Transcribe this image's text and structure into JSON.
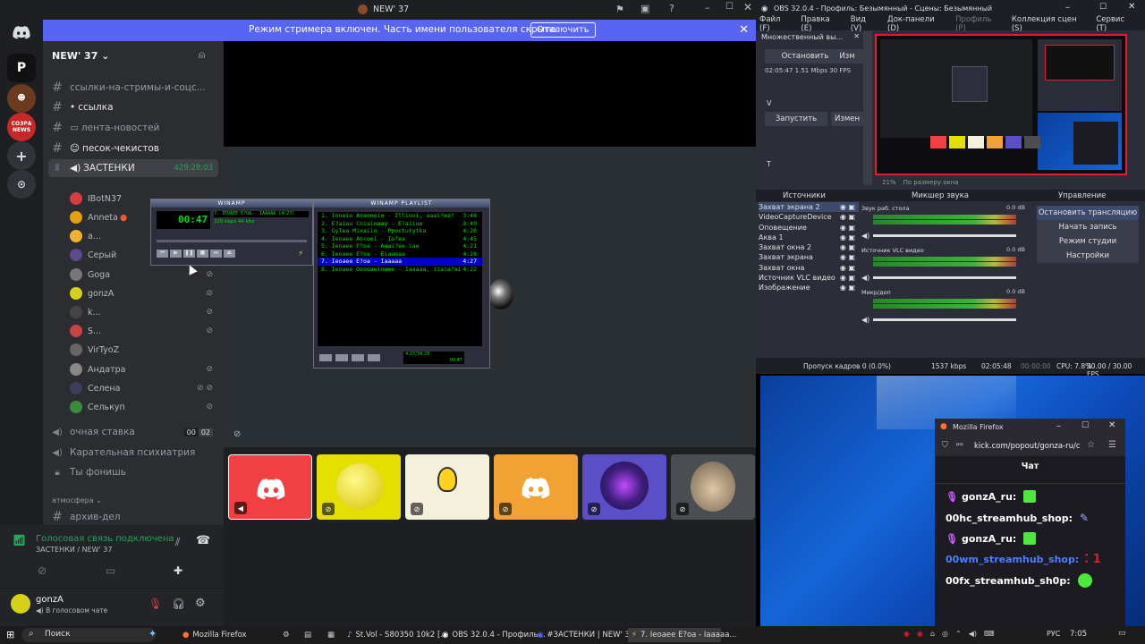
{
  "discord": {
    "window_title": "NEW' 37",
    "banner": {
      "text": "Режим стримера включен. Часть имени пользователя скрыта.",
      "button": "Отключить"
    },
    "server_name": "NEW' 37",
    "channels": [
      {
        "label": "ссылки-на-стримы-и-соцс...",
        "type": "text"
      },
      {
        "label": "ссылка",
        "type": "text",
        "prefix": "•"
      },
      {
        "label": "лента-новостей",
        "type": "text",
        "prefix": "▭"
      },
      {
        "label": "песок-чекистов",
        "type": "text",
        "prefix": "☺"
      },
      {
        "label": "ЗАСТЕНКИ",
        "type": "voice",
        "timer": "429:28:03"
      }
    ],
    "voice_users": [
      {
        "name": "IBotN37",
        "color": "#d83c3e"
      },
      {
        "name": "Anneta",
        "color": "#e5a00d"
      },
      {
        "name": "a...",
        "color": "#f0b232"
      },
      {
        "name": "Серый",
        "color": "#5b4a8c"
      },
      {
        "name": "Goga",
        "color": "#777777"
      },
      {
        "name": "gonzA",
        "color": "#d6d21c"
      },
      {
        "name": "k...",
        "color": "#444444"
      },
      {
        "name": "S...",
        "color": "#c94343"
      },
      {
        "name": "VirTyoZ",
        "color": "#666666"
      },
      {
        "name": "Андатра",
        "color": "#888888"
      },
      {
        "name": "Селена",
        "color": "#3d3d5c"
      },
      {
        "name": "Селькуп",
        "color": "#3a8c3a"
      }
    ],
    "more_channels": [
      {
        "label": "очная ставка",
        "type": "voice",
        "count_a": "00",
        "count_b": "02"
      },
      {
        "label": "Карательная психиатрия",
        "type": "voice"
      },
      {
        "label": "Ты фонишь",
        "type": "voice-locked"
      }
    ],
    "category": "атмосфера",
    "archive": "архив-дел",
    "voice_status": "Голосовая связь подключена",
    "voice_location": "ЗАСТЕНКИ / NEW' 37",
    "user": {
      "name": "gonzA",
      "status": "В голосовом чате"
    }
  },
  "winamp": {
    "title": "WINAMP",
    "time": "00:47",
    "track": "7. IEOAEE E?OA - IAAAAA (4:27)",
    "kbps": "320",
    "khz": "44",
    "playlist_title": "WINAMP PLAYLIST",
    "playlist": [
      {
        "n": "1.",
        "title": "Iooeio Aoaonoio - Illiooi, aaai?ea?",
        "dur": "3:48"
      },
      {
        "n": "2.",
        "title": "E?aiau Cniainaay - E?aiiue",
        "dur": "3:40"
      },
      {
        "n": "3.",
        "title": "Gylea Mixaiin - Ppoctutytka",
        "dur": "4:26"
      },
      {
        "n": "4.",
        "title": "Ieoaee Aocuei - Io?ea",
        "dur": "4:45"
      },
      {
        "n": "5.",
        "title": "Ieoaee E?oa - Aaai?ee iae",
        "dur": "4:21"
      },
      {
        "n": "6.",
        "title": "Ieoaee E?oa - Eiauoaa",
        "dur": "4:28"
      },
      {
        "n": "7.",
        "title": "Ieoaee E?oa - Iaaaaa",
        "dur": "4:27",
        "selected": true
      },
      {
        "n": "8.",
        "title": "Ieoaee Ooooaeinaee - Iaaaaa, iiaia?ei",
        "dur": "4:22"
      }
    ],
    "pl_time": "4:27/34:28",
    "pl_pos": "00:47"
  },
  "obs": {
    "title": "OBS 32.0.4 - Профиль: Безымянный - Сцены: Безымянный",
    "menu": [
      "Файл (F)",
      "Правка (E)",
      "Вид (V)",
      "Док-панели (D)",
      "Профиль (P)",
      "Коллекция сцен (S)",
      "Сервис (T)"
    ],
    "dock_title": "Множественный вы...",
    "stop_btn": "Остановить",
    "stats": "02:05:47  1.51 Mbps  30 FPS",
    "start_btn": "Запустить",
    "v_label": "V",
    "t_label": "T",
    "zoom": "21%",
    "fit_label": "По размеру окна",
    "sources_header": "Источники",
    "mixer_header": "Микшер звука",
    "controls_header": "Управление",
    "sources": [
      {
        "name": "Захват экрана 2",
        "selected": true
      },
      {
        "name": "VideoCaptureDevice"
      },
      {
        "name": "Оповещение"
      },
      {
        "name": "Аква 1"
      },
      {
        "name": "Захват окна 2"
      },
      {
        "name": "Захват экрана"
      },
      {
        "name": "Захват окна"
      },
      {
        "name": "Источник VLC видео"
      },
      {
        "name": "Изображение"
      }
    ],
    "mixer": [
      {
        "name": "Звук раб. стола",
        "db": "0.0 dB"
      },
      {
        "name": "Источник VLC видео",
        "db": "0.0 dB"
      },
      {
        "name": "Микр/доп",
        "db": "0.0 dB"
      }
    ],
    "controls": [
      "Остановить трансляцию",
      "Начать запись",
      "Режим студии",
      "Настройки"
    ],
    "status": {
      "dropped": "Пропуск кадров 0 (0.0%)",
      "kbps": "1537 kbps",
      "live": "02:05:48",
      "rec": "00:00:00",
      "cpu": "CPU: 7.8%",
      "fps": "30.00 / 30.00 FPS"
    }
  },
  "firefox": {
    "title": "Mozilla Firefox",
    "url": "kick.com/popout/gonza-ru/c",
    "chat_title": "Чат",
    "messages": [
      {
        "user": "gonzA_ru:",
        "color": "#ffffff",
        "badge": true
      },
      {
        "user": "00hc_streamhub_shop:",
        "color": "#ffffff"
      },
      {
        "user": "gonzA_ru:",
        "color": "#ffffff",
        "badge": true
      },
      {
        "user": "00wm_streamhub_shop:",
        "color": "#4f7dff"
      },
      {
        "user": "00fx_streamhub_sh0p:",
        "color": "#ffffff"
      }
    ]
  },
  "taskbar": {
    "search": "Поиск",
    "items": [
      {
        "label": "Mozilla Firefox"
      },
      {
        "label": ""
      },
      {
        "label": ""
      },
      {
        "label": "St.Vol - S80350 10k2 [..."
      },
      {
        "label": "OBS 32.0.4 - Профиль..."
      },
      {
        "label": "#ЗАСТЕНКИ | NEW' 3..."
      },
      {
        "label": "7. Ieoaee E?oa - Iaaaaa..."
      }
    ],
    "lang": "РУС",
    "clock": "7:05"
  }
}
